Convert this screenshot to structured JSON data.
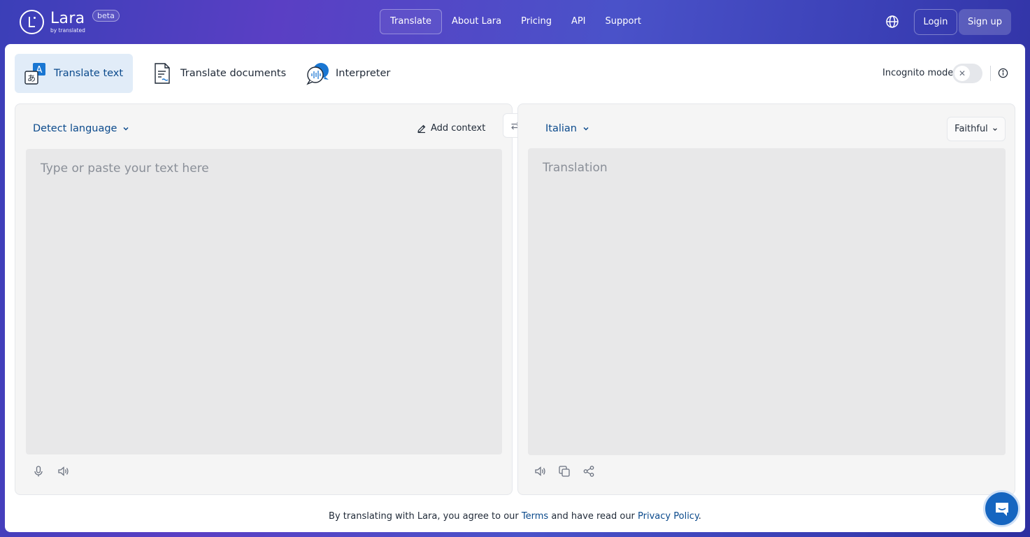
{
  "header": {
    "logo_name": "Lara",
    "logo_sub": "by translated",
    "beta": "beta",
    "nav": [
      "Translate",
      "About Lara",
      "Pricing",
      "API",
      "Support"
    ],
    "login": "Login",
    "signup": "Sign up"
  },
  "modes": {
    "translate_text": "Translate text",
    "translate_documents": "Translate documents",
    "interpreter": "Interpreter"
  },
  "incognito": {
    "label": "Incognito mode",
    "enabled": false
  },
  "source": {
    "language": "Detect language",
    "add_context": "Add context",
    "placeholder": "Type or paste your text here"
  },
  "target": {
    "language": "Italian",
    "style": "Faithful",
    "placeholder": "Translation"
  },
  "footer": {
    "prefix": "By translating with Lara, you agree to our ",
    "terms": "Terms",
    "middle": " and have read our ",
    "privacy": "Privacy Policy",
    "suffix": "."
  },
  "colors": {
    "accent": "#0b4a8c",
    "tab_active_bg": "#e1ecf8",
    "chat_button": "#1565c0"
  }
}
